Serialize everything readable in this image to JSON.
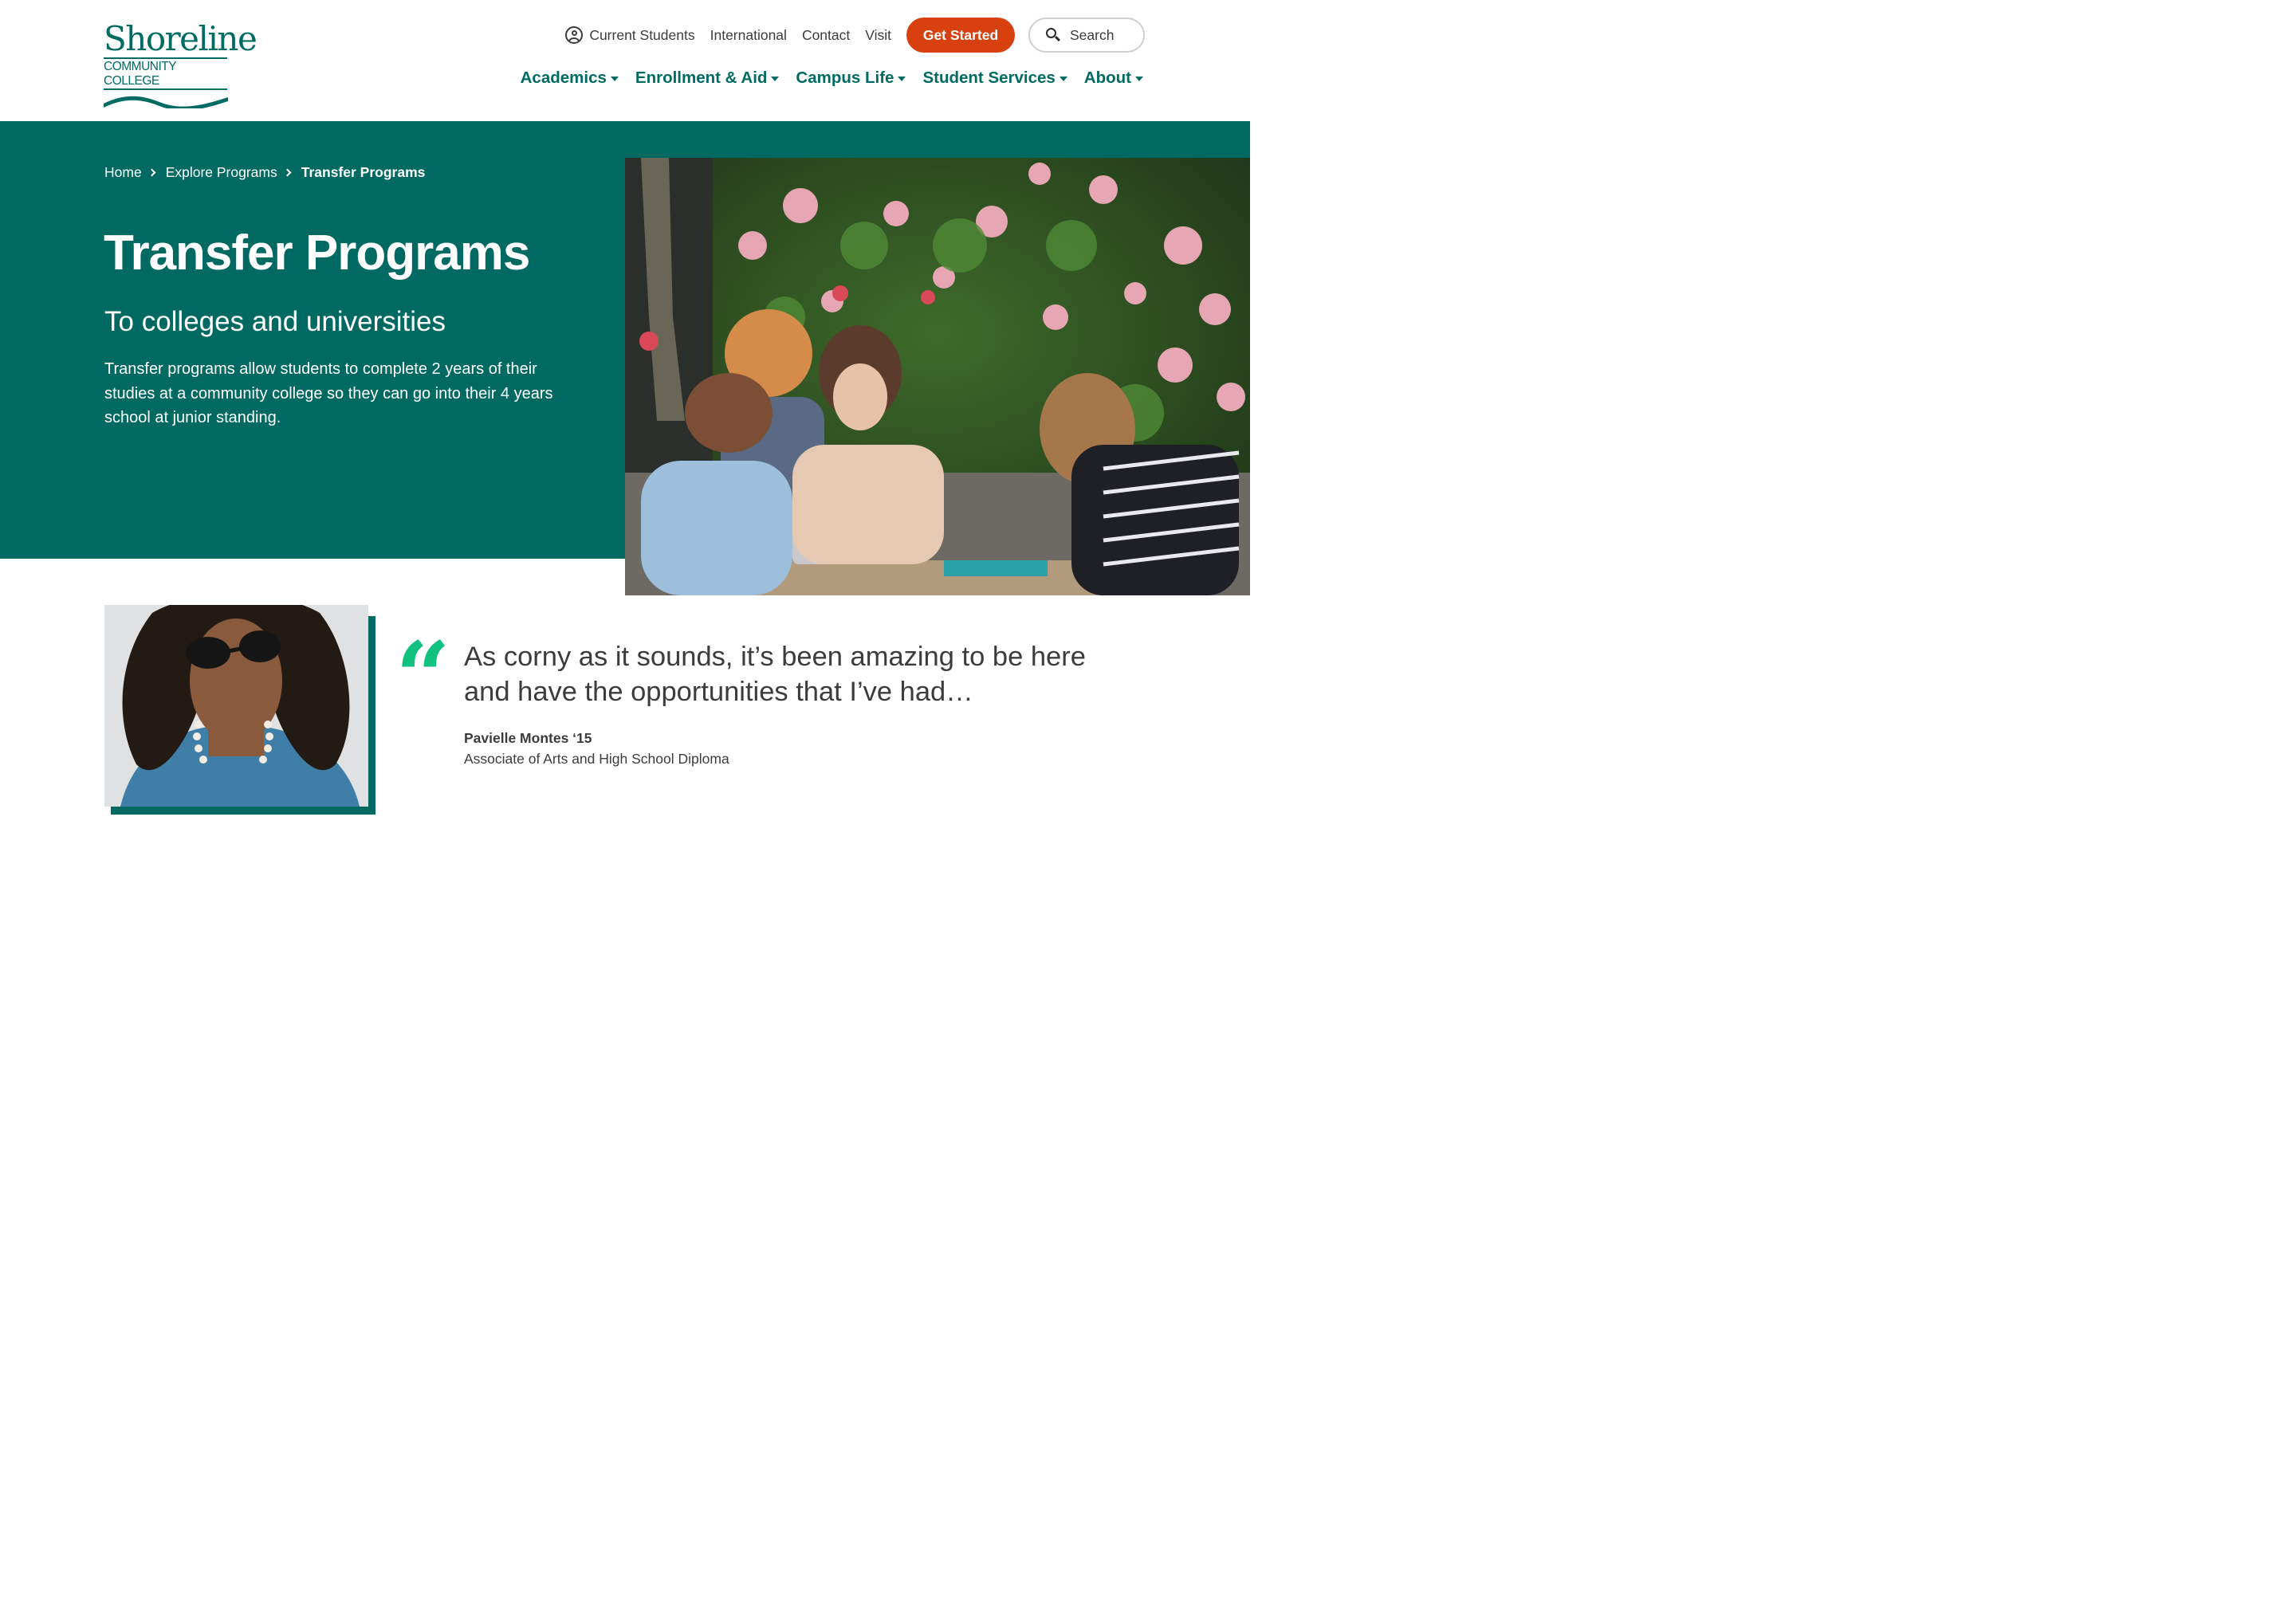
{
  "logo": {
    "name": "Shoreline",
    "subtitle": "COMMUNITY COLLEGE"
  },
  "util_nav": {
    "current_students": "Current Students",
    "international": "International",
    "contact": "Contact",
    "visit": "Visit",
    "get_started": "Get Started",
    "search": "Search"
  },
  "main_nav": {
    "items": [
      {
        "label": "Academics"
      },
      {
        "label": "Enrollment & Aid"
      },
      {
        "label": "Campus Life"
      },
      {
        "label": "Student Services"
      },
      {
        "label": "About"
      }
    ]
  },
  "breadcrumb": {
    "home": "Home",
    "explore": "Explore Programs",
    "current": "Transfer Programs"
  },
  "hero": {
    "title": "Transfer Programs",
    "subtitle": "To colleges and universities",
    "description": "Transfer programs allow students to complete 2 years of their studies at a community college so they can go into their 4 years school at junior standing."
  },
  "testimonial": {
    "quote_mark": "“",
    "quote": "As corny as it sounds, it’s been amazing to be here and have the opportunities that I’ve had…",
    "name": "Pavielle Montes ‘15",
    "role": "Associate of Arts and High School Diploma"
  },
  "colors": {
    "brand_green": "#006961",
    "cta_orange": "#d94010",
    "quote_green": "#10c17f"
  }
}
